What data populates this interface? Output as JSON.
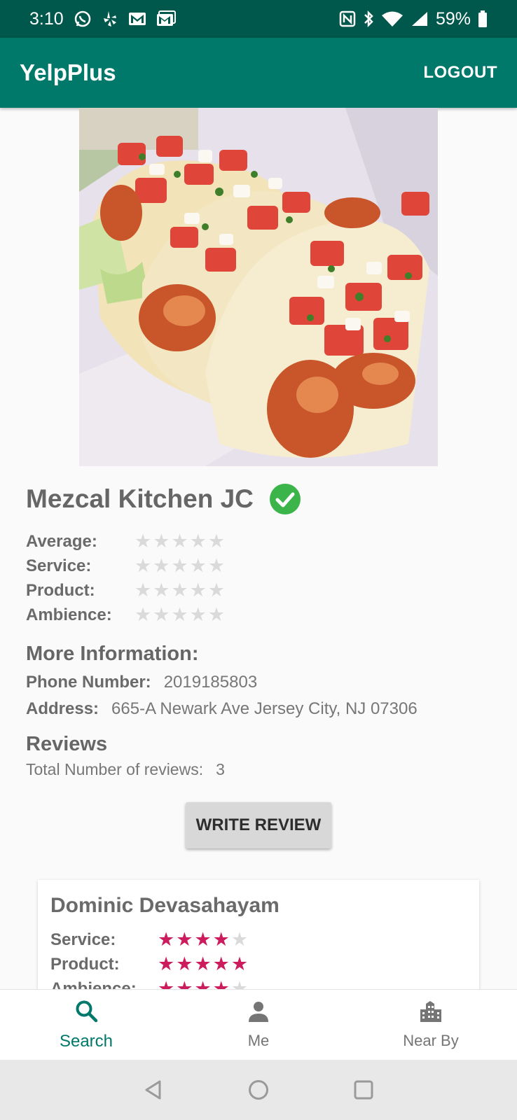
{
  "status_bar": {
    "time": "3:10",
    "battery": "59%",
    "left_icons": [
      "whatsapp-icon",
      "yelp-icon",
      "gmail-icon",
      "gmail-icon"
    ],
    "right_icons": [
      "nfc-icon",
      "bluetooth-icon",
      "wifi-icon",
      "cell-signal-icon",
      "battery-icon"
    ]
  },
  "app_bar": {
    "title": "YelpPlus",
    "logout_label": "LOGOUT"
  },
  "business": {
    "name": "Mezcal Kitchen JC",
    "verified": true,
    "ratings": [
      {
        "label": "Average:",
        "value": 0,
        "max": 5
      },
      {
        "label": "Service:",
        "value": 0,
        "max": 5
      },
      {
        "label": "Product:",
        "value": 0,
        "max": 5
      },
      {
        "label": "Ambience:",
        "value": 0,
        "max": 5
      }
    ],
    "more_info_title": "More Information:",
    "phone_label": "Phone Number:",
    "phone": "2019185803",
    "address_label": "Address:",
    "address": "665-A Newark Ave Jersey City, NJ 07306"
  },
  "reviews": {
    "title": "Reviews",
    "count_label": "Total Number of reviews:",
    "count": "3",
    "write_label": "WRITE REVIEW",
    "items": [
      {
        "reviewer": "Dominic Devasahayam",
        "ratings": [
          {
            "label": "Service:",
            "value": 4,
            "max": 5
          },
          {
            "label": "Product:",
            "value": 5,
            "max": 5
          },
          {
            "label": "Ambience:",
            "value": 4,
            "max": 5
          }
        ]
      }
    ]
  },
  "bottom_nav": {
    "items": [
      {
        "label": "Search",
        "icon": "search-icon",
        "active": true
      },
      {
        "label": "Me",
        "icon": "person-icon",
        "active": false
      },
      {
        "label": "Near By",
        "icon": "city-icon",
        "active": false
      }
    ]
  },
  "colors": {
    "status_bar": "#00574b",
    "app_bar": "#00796b",
    "star_on": "#cc1c5e",
    "star_off": "#dadada",
    "verified": "#3bb54a"
  }
}
